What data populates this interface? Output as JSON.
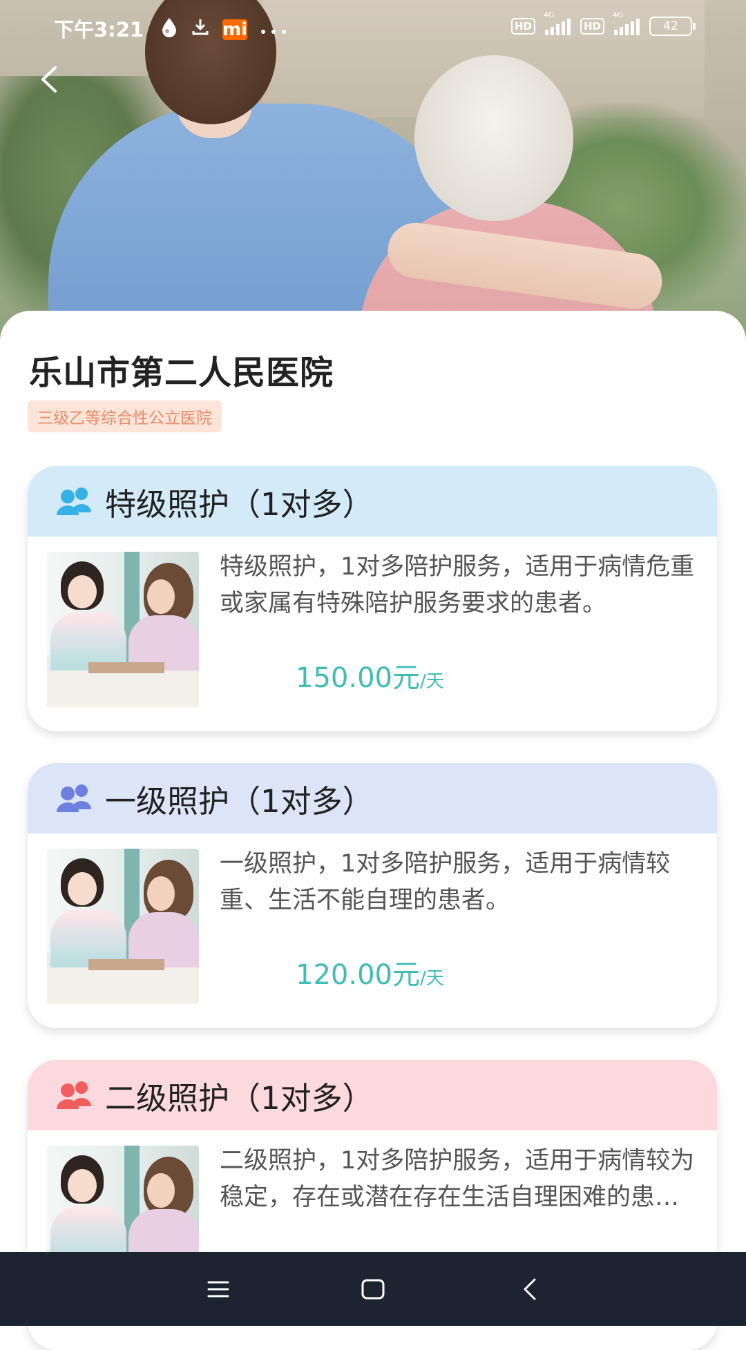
{
  "status_bar": {
    "time": "下午3:21",
    "mi_badge": "mi",
    "hd1": "HD",
    "hd2": "HD",
    "signal1_label": "4G",
    "signal2_label": "4G",
    "battery": "42"
  },
  "hospital": {
    "name": "乐山市第二人民医院",
    "tag": "三级乙等综合性公立医院"
  },
  "care_levels": [
    {
      "title": "特级照护（1对多）",
      "description": "特级照护，1对多陪护服务，适用于病情危重或家属有特殊陪护服务要求的患者。",
      "price": "150.00元",
      "unit": "/天",
      "header_color": "#d3eaf8",
      "icon_color": "#35b1e6"
    },
    {
      "title": "一级照护（1对多）",
      "description": "一级照护，1对多陪护服务，适用于病情较重、生活不能自理的患者。",
      "price": "120.00元",
      "unit": "/天",
      "header_color": "#dce5f7",
      "icon_color": "#6d7fe0"
    },
    {
      "title": "二级照护（1对多）",
      "description": "二级照护，1对多陪护服务，适用于病情较为稳定，存在或潜在存在生活自理困难的患者。",
      "header_color": "#fbd9de",
      "icon_color": "#ef5d5d"
    }
  ],
  "colors": {
    "price": "#3fbcb6",
    "tag_bg": "#fde4d9",
    "tag_text": "#ea8b66",
    "nav_bar": "#1c2331"
  },
  "icons": {
    "back": "back-arrow-icon",
    "people": "people-group-icon",
    "nav_menu": "menu-icon",
    "nav_home": "home-square-icon",
    "nav_back": "back-chevron-icon"
  }
}
